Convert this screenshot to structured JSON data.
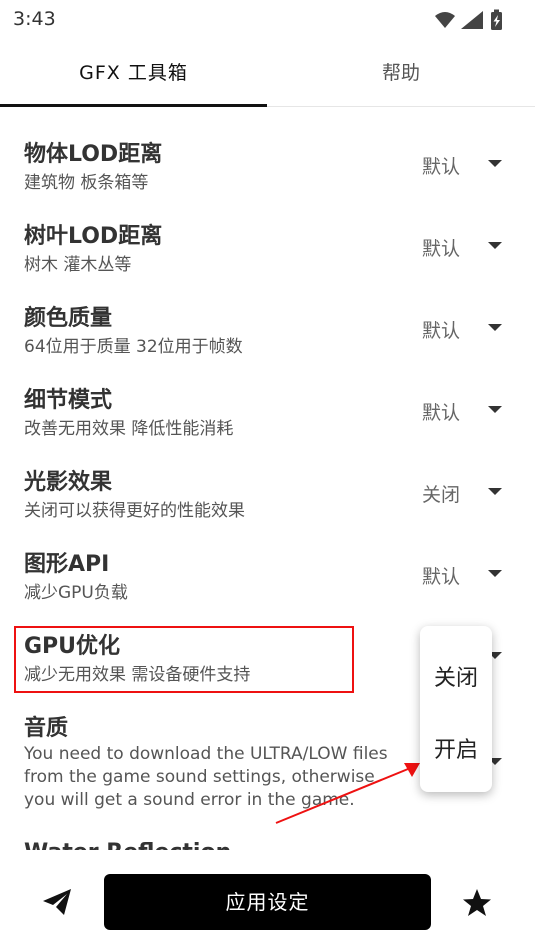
{
  "status": {
    "time": "3:43"
  },
  "tabs": [
    {
      "label": "GFX 工具箱"
    },
    {
      "label": "帮助"
    }
  ],
  "settings": [
    {
      "title": "物体LOD距离",
      "subtitle": "建筑物 板条箱等",
      "value": "默认"
    },
    {
      "title": "树叶LOD距离",
      "subtitle": "树木 灌木丛等",
      "value": "默认"
    },
    {
      "title": "颜色质量",
      "subtitle": "64位用于质量 32位用于帧数",
      "value": "默认"
    },
    {
      "title": "细节模式",
      "subtitle": "改善无用效果 降低性能消耗",
      "value": "默认"
    },
    {
      "title": "光影效果",
      "subtitle": "关闭可以获得更好的性能效果",
      "value": "关闭"
    },
    {
      "title": "图形API",
      "subtitle": "减少GPU负载",
      "value": "默认"
    },
    {
      "title": "GPU优化",
      "subtitle": "减少无用效果 需设备硬件支持",
      "value": ""
    },
    {
      "title": "音质",
      "subtitle_lines": [
        "You need to download the ULTRA/LOW files",
        "from the game sound settings, otherwise",
        "you will get a sound error in the game."
      ],
      "value": ""
    },
    {
      "title": "Water Reflection"
    }
  ],
  "dropdown": {
    "options": [
      "关闭",
      "开启"
    ]
  },
  "bottom": {
    "apply_label": "应用设定"
  },
  "colors": {
    "highlight": "#e11111",
    "button_bg": "#000000"
  },
  "icons": {
    "left": "send-icon",
    "right": "star-icon"
  }
}
